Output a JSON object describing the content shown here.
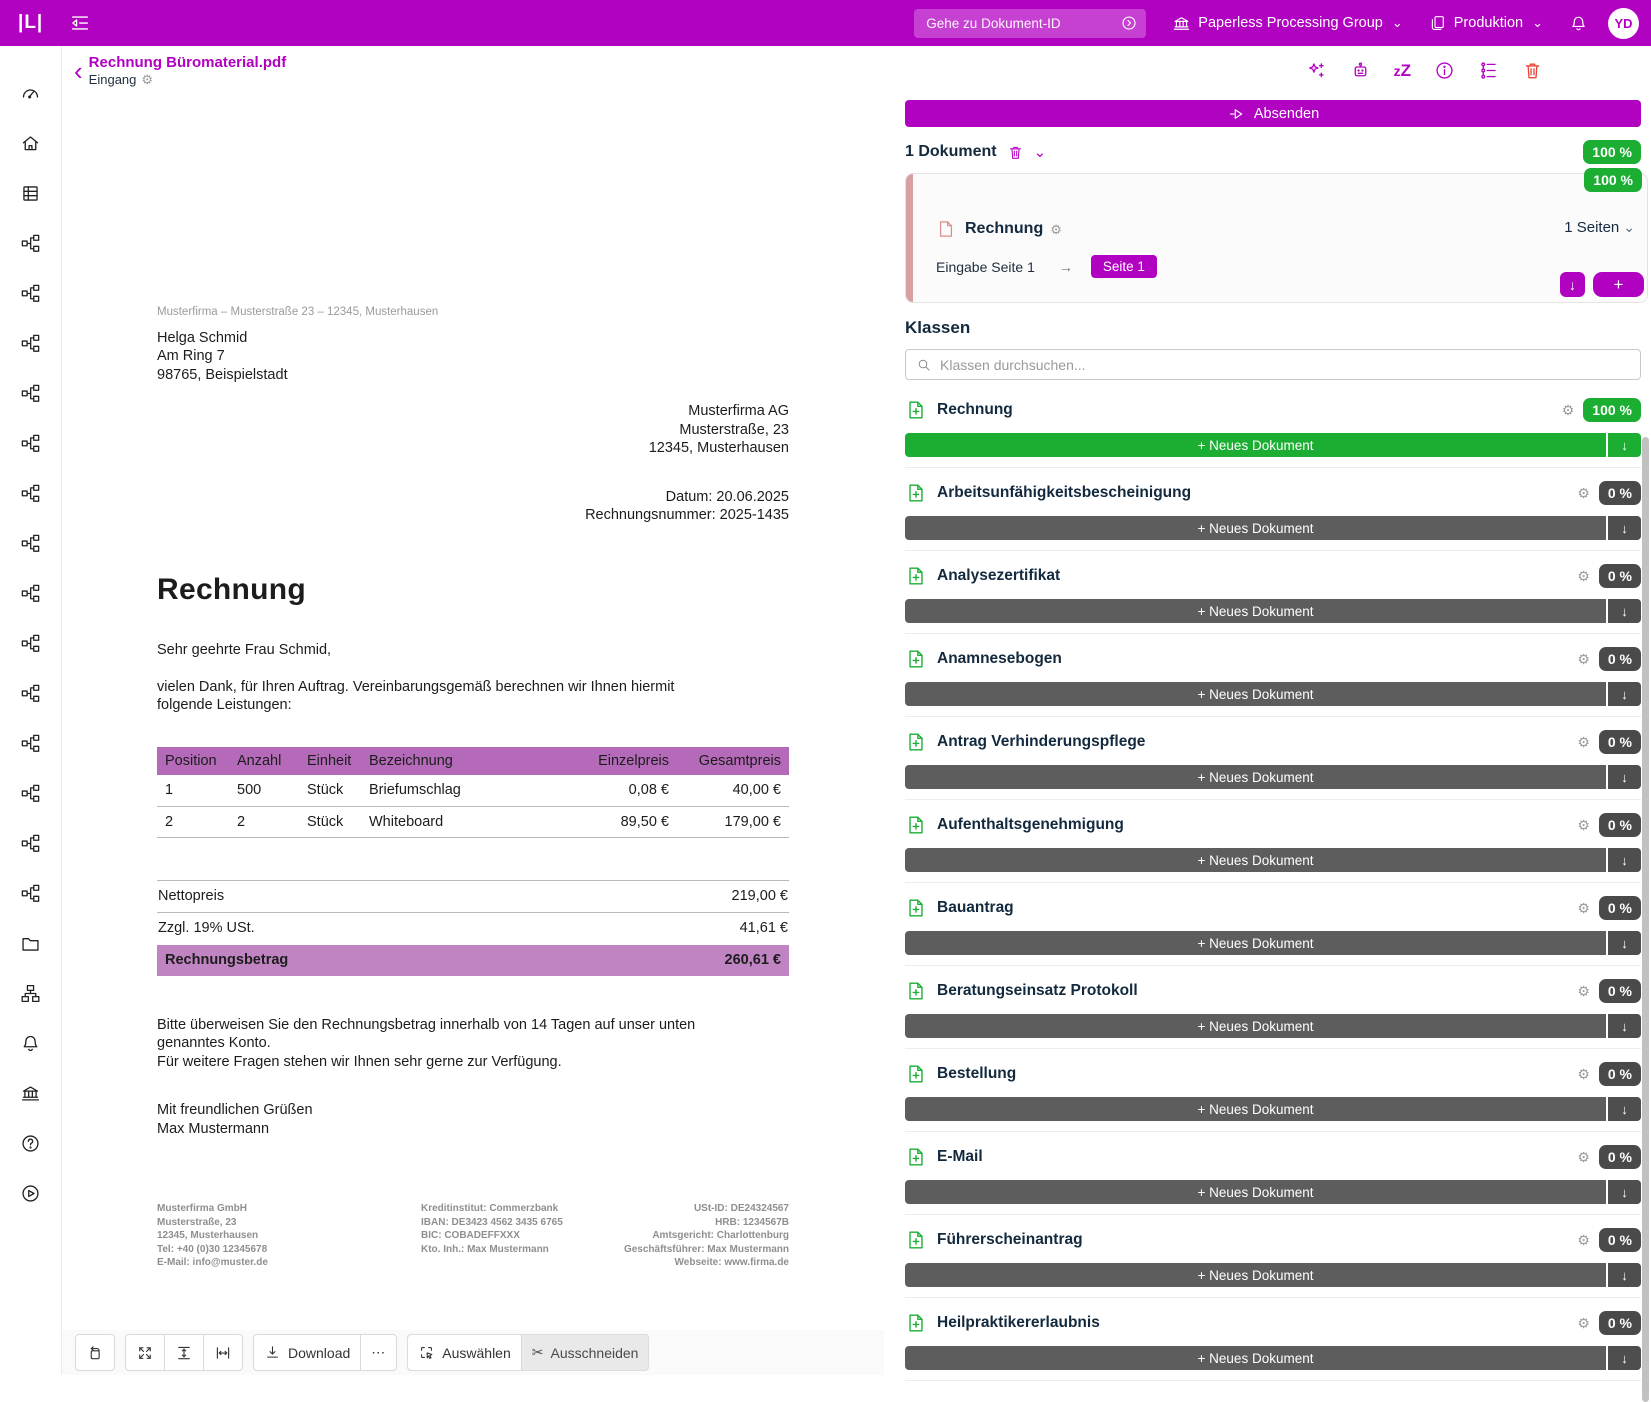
{
  "colors": {
    "accent": "#b101c1",
    "green": "#1bae33",
    "danger": "#e8443a",
    "table_header": "#b56ab9",
    "total_row": "#c084c3"
  },
  "topbar": {
    "logo": "|L|",
    "search_placeholder": "Gehe zu Dokument-ID",
    "group_label": "Paperless Processing Group",
    "env_label": "Produktion",
    "avatar": "YD"
  },
  "sidebar_icons": [
    "dashboard",
    "home",
    "table",
    "flow",
    "flow",
    "flow",
    "flow",
    "flow",
    "flow",
    "flow",
    "flow",
    "flow",
    "flow",
    "flow",
    "flow",
    "flow",
    "flow",
    "folder",
    "sitemap",
    "bell",
    "bank",
    "help",
    "play"
  ],
  "header": {
    "title": "Rechnung Büromaterial.pdf",
    "subtitle": "Eingang",
    "action_icons": [
      "sparkles-icon",
      "robot-icon",
      "sleep-icon",
      "info-icon",
      "tree-icon",
      "trash-icon"
    ]
  },
  "viewer_toolbar": {
    "download_label": "Download",
    "more_label": "⋯",
    "select_label": "Auswählen",
    "cut_label": "Ausschneiden"
  },
  "document": {
    "sender_line": "Musterfirma – Musterstraße 23 – 12345, Musterhausen",
    "recipient": [
      "Helga Schmid",
      "Am Ring 7",
      "98765, Beispielstadt"
    ],
    "company_block": [
      "Musterfirma AG",
      "Musterstraße, 23",
      "12345, Musterhausen"
    ],
    "date_line": "Datum: 20.06.2025",
    "invoice_no_line": "Rechnungsnummer: 2025-1435",
    "title": "Rechnung",
    "salutation": "Sehr geehrte Frau Schmid,",
    "intro": "vielen Dank, für Ihren Auftrag. Vereinbarungsgemäß berechnen wir Ihnen hiermit folgende Leistungen:",
    "table": {
      "headers": [
        "Position",
        "Anzahl",
        "Einheit",
        "Bezeichnung",
        "Einzelpreis",
        "Gesamtpreis"
      ],
      "rows": [
        [
          "1",
          "500",
          "Stück",
          "Briefumschlag",
          "0,08 €",
          "40,00 €"
        ],
        [
          "2",
          "2",
          "Stück",
          "Whiteboard",
          "89,50 €",
          "179,00 €"
        ]
      ]
    },
    "totals": [
      {
        "label": "Nettopreis",
        "value": "219,00 €"
      },
      {
        "label": "Zzgl. 19% USt.",
        "value": "41,61 €"
      },
      {
        "label": "Rechnungsbetrag",
        "value": "260,61 €"
      }
    ],
    "outro": [
      "Bitte überweisen Sie den Rechnungsbetrag innerhalb von 14 Tagen auf unser unten genanntes Konto.",
      "Für weitere Fragen stehen wir Ihnen sehr gerne zur Verfügung."
    ],
    "closing": [
      "Mit freundlichen Grüßen",
      "Max Mustermann"
    ],
    "footer_col1": [
      "Musterfirma GmbH",
      "Musterstraße, 23",
      "12345, Musterhausen",
      "Tel: +40 (0)30 12345678",
      "E-Mail: info@muster.de"
    ],
    "footer_col2": [
      "Kreditinstitut: Commerzbank",
      "IBAN: DE3423 4562 3435 6765",
      "BIC: COBADEFFXXX",
      "Kto. Inh.: Max Mustermann"
    ],
    "footer_col3": [
      "USt-ID: DE24324567",
      "HRB: 1234567B",
      "Amtsgericht: Charlottenburg",
      "Geschäftsführer: Max Mustermann",
      "Webseite: www.firma.de"
    ]
  },
  "panel": {
    "send_label": "Absenden",
    "doc_count_label": "1 Dokument",
    "overall_score": "100 %",
    "card": {
      "score": "100 %",
      "name": "Rechnung",
      "pages_label": "1 Seiten",
      "input_label": "Eingabe Seite 1",
      "arrow": "→",
      "page_chip": "Seite 1",
      "down_label": "↓",
      "plus_label": "+"
    },
    "classes_title": "Klassen",
    "search_placeholder": "Klassen durchsuchen...",
    "new_doc_label": "+ Neues Dokument",
    "arrow_label": "↓",
    "classes": [
      {
        "name": "Rechnung",
        "score": "100 %"
      },
      {
        "name": "Arbeitsunfähigkeitsbescheinigung",
        "score": "0 %"
      },
      {
        "name": "Analysezertifikat",
        "score": "0 %"
      },
      {
        "name": "Anamnesebogen",
        "score": "0 %"
      },
      {
        "name": "Antrag Verhinderungspflege",
        "score": "0 %"
      },
      {
        "name": "Aufenthaltsgenehmigung",
        "score": "0 %"
      },
      {
        "name": "Bauantrag",
        "score": "0 %"
      },
      {
        "name": "Beratungseinsatz Protokoll",
        "score": "0 %"
      },
      {
        "name": "Bestellung",
        "score": "0 %"
      },
      {
        "name": "E-Mail",
        "score": "0 %"
      },
      {
        "name": "Führerscheinantrag",
        "score": "0 %"
      },
      {
        "name": "Heilpraktikererlaubnis",
        "score": "0 %"
      }
    ]
  }
}
